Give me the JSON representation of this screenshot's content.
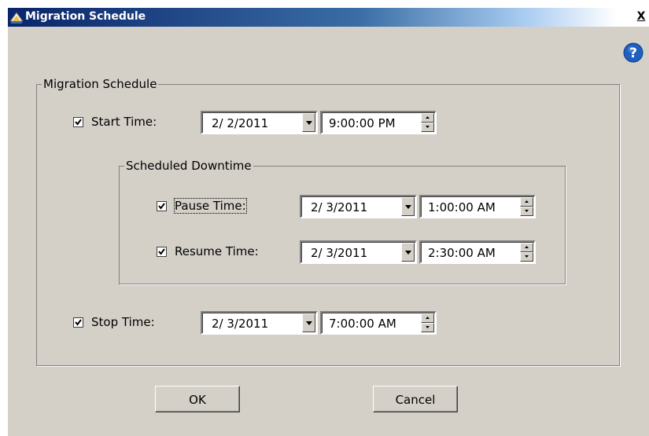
{
  "window": {
    "title": "Migration Schedule",
    "close_label": "X"
  },
  "group": {
    "legend": "Migration Schedule"
  },
  "start": {
    "checked": true,
    "label": "Start Time:",
    "date": "2/ 2/2011",
    "time": "9:00:00 PM"
  },
  "downtime": {
    "legend": "Scheduled Downtime",
    "pause": {
      "checked": true,
      "label": "Pause Time:",
      "date": "2/ 3/2011",
      "time": "1:00:00 AM"
    },
    "resume": {
      "checked": true,
      "label": "Resume Time:",
      "date": "2/ 3/2011",
      "time": "2:30:00 AM"
    }
  },
  "stop": {
    "checked": true,
    "label": "Stop Time:",
    "date": "2/ 3/2011",
    "time": "7:00:00 AM"
  },
  "buttons": {
    "ok": "OK",
    "cancel": "Cancel"
  },
  "colors": {
    "titlebar": "#0a246a",
    "face": "#d4d0c8",
    "help": "#1f5fbf"
  },
  "icons": {
    "title": "app-icon",
    "help": "help-icon",
    "dropdown": "chevron-down-icon"
  }
}
